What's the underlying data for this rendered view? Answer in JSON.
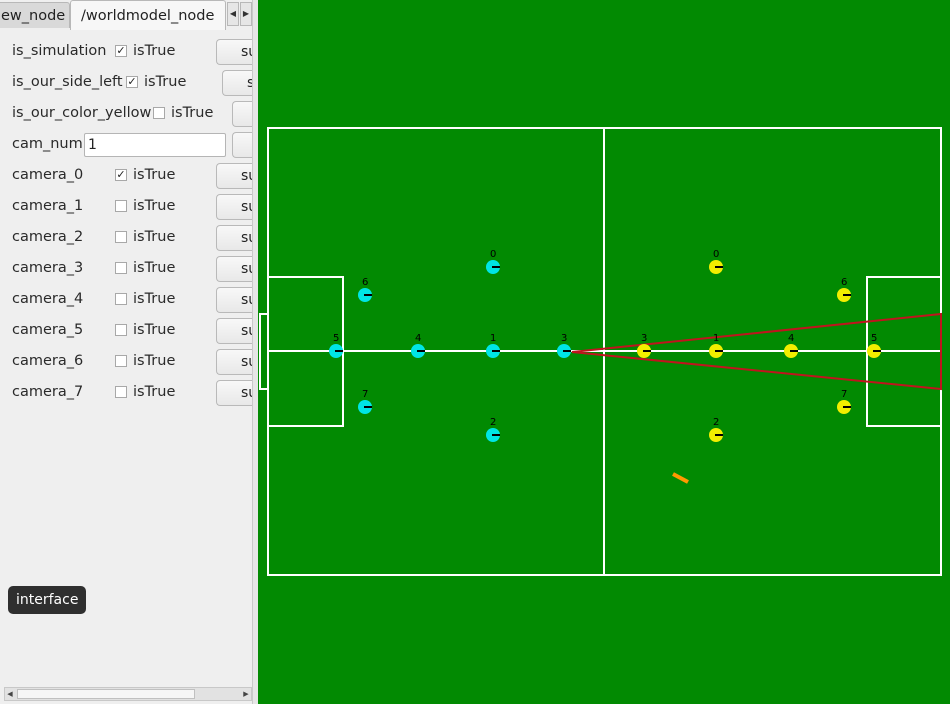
{
  "tabs": [
    {
      "label": "ew_node",
      "active": false
    },
    {
      "label": "/worldmodel_node",
      "active": true
    }
  ],
  "tab_scroll": {
    "left": "◀",
    "right": "▶"
  },
  "params": [
    {
      "label": "is_simulation",
      "type": "checkbox",
      "checked": true,
      "check_text": "isTrue",
      "button": "su"
    },
    {
      "label": "is_our_side_left",
      "type": "checkbox",
      "checked": true,
      "check_text": "isTrue",
      "button": "su"
    },
    {
      "label": "is_our_color_yellow",
      "type": "checkbox",
      "checked": false,
      "check_text": "isTrue",
      "button": "s"
    },
    {
      "label": "cam_num",
      "type": "text",
      "value": "1",
      "button": "s"
    },
    {
      "label": "camera_0",
      "type": "checkbox",
      "checked": true,
      "check_text": "isTrue",
      "button": "su"
    },
    {
      "label": "camera_1",
      "type": "checkbox",
      "checked": false,
      "check_text": "isTrue",
      "button": "su"
    },
    {
      "label": "camera_2",
      "type": "checkbox",
      "checked": false,
      "check_text": "isTrue",
      "button": "su"
    },
    {
      "label": "camera_3",
      "type": "checkbox",
      "checked": false,
      "check_text": "isTrue",
      "button": "su"
    },
    {
      "label": "camera_4",
      "type": "checkbox",
      "checked": false,
      "check_text": "isTrue",
      "button": "su"
    },
    {
      "label": "camera_5",
      "type": "checkbox",
      "checked": false,
      "check_text": "isTrue",
      "button": "su"
    },
    {
      "label": "camera_6",
      "type": "checkbox",
      "checked": false,
      "check_text": "isTrue",
      "button": "su"
    },
    {
      "label": "camera_7",
      "type": "checkbox",
      "checked": false,
      "check_text": "isTrue",
      "button": "su"
    }
  ],
  "interface_label": "interface",
  "field": {
    "colors": {
      "grass": "#028a02",
      "lines": "#ffffff",
      "blue_team": "#00e5e5",
      "yellow_team": "#f2ee00",
      "aim": "#c0141e",
      "ball": "#ff9900"
    },
    "blue_robots": [
      {
        "id": "0"
      },
      {
        "id": "6"
      },
      {
        "id": "5"
      },
      {
        "id": "4"
      },
      {
        "id": "1"
      },
      {
        "id": "3"
      },
      {
        "id": "7"
      },
      {
        "id": "2"
      }
    ],
    "yellow_robots": [
      {
        "id": "0"
      },
      {
        "id": "6"
      },
      {
        "id": "3"
      },
      {
        "id": "1"
      },
      {
        "id": "4"
      },
      {
        "id": "5"
      },
      {
        "id": "7"
      },
      {
        "id": "2"
      }
    ]
  }
}
